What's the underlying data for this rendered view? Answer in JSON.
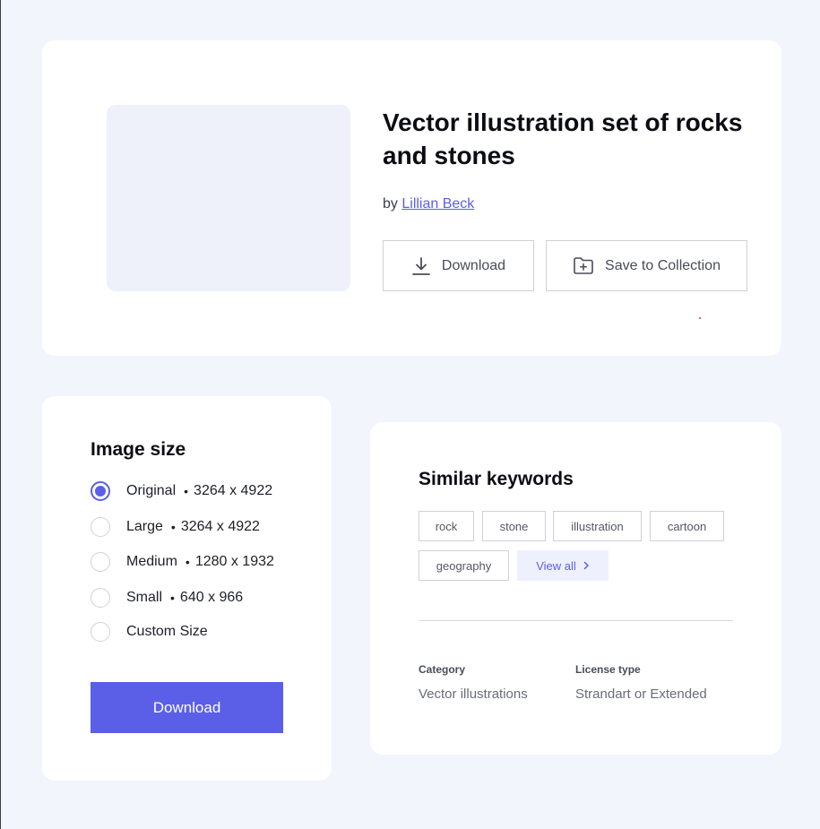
{
  "product": {
    "title": "Vector illustration set of rocks and stones",
    "by_label": "by",
    "author": "Lillian Beck",
    "download_label": "Download",
    "save_label": "Save to Collection"
  },
  "image_size": {
    "heading": "Image size",
    "selected_index": 0,
    "options": [
      {
        "label": "Original",
        "dims": "3264 x 4922"
      },
      {
        "label": "Large",
        "dims": "3264 x 4922"
      },
      {
        "label": "Medium",
        "dims": "1280 x 1932"
      },
      {
        "label": "Small",
        "dims": "640 x 966"
      },
      {
        "label": "Custom Size",
        "dims": ""
      }
    ],
    "separator": "•",
    "download_label": "Download"
  },
  "keywords": {
    "heading": "Similar keywords",
    "tags": [
      "rock",
      "stone",
      "illustration",
      "cartoon",
      "geography"
    ],
    "view_all": "View all",
    "view_all_icon": "chevron-right-icon"
  },
  "meta": {
    "category_label": "Category",
    "category_value": "Vector illustrations",
    "license_label": "License type",
    "license_value": "Strandart or Extended"
  },
  "colors": {
    "accent": "#5b5fe8",
    "background": "#f2f5fc",
    "card": "#ffffff",
    "thumbnail": "#eef1fa"
  },
  "icons": {
    "download": "download-icon",
    "save": "folder-plus-icon"
  }
}
